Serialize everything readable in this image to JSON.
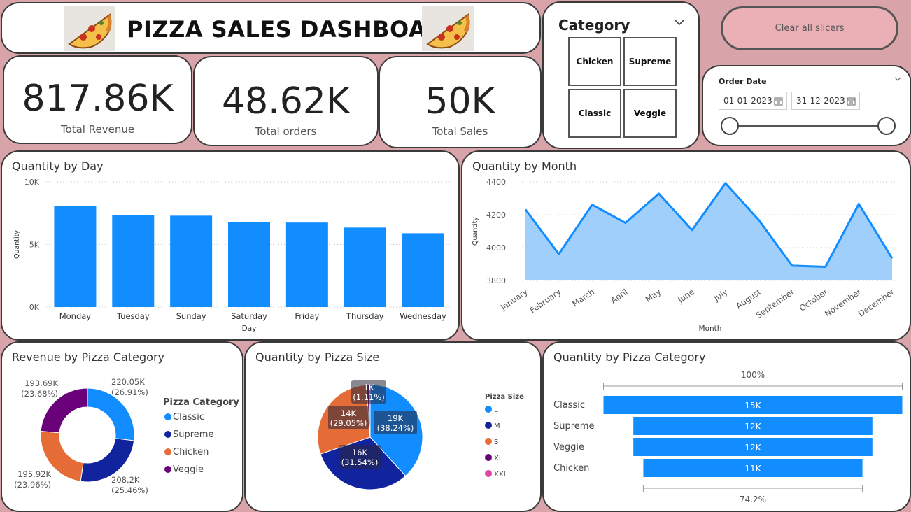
{
  "header": {
    "title": "PIZZA SALES DASHBOARD"
  },
  "kpis": [
    {
      "value": "817.86K",
      "label": "Total Revenue"
    },
    {
      "value": "48.62K",
      "label": "Total orders"
    },
    {
      "value": "50K",
      "label": "Total Sales"
    }
  ],
  "category_slicer": {
    "title": "Category",
    "options": [
      "Chicken",
      "Supreme",
      "Classic",
      "Veggie"
    ]
  },
  "clear_button": {
    "label": "Clear all slicers"
  },
  "date_slicer": {
    "title": "Order Date",
    "start": "01-01-2023",
    "end": "31-12-2023"
  },
  "colors": {
    "accent": "#118dff",
    "background": "#d8a4aa",
    "dark_blue": "#12239e",
    "orange": "#e66c37",
    "purple": "#6b007b",
    "pink": "#e044a7",
    "area_fill": "#a0cffb"
  },
  "chart_data": [
    {
      "type": "bar",
      "title": "Quantity by Day",
      "xlabel": "Day",
      "ylabel": "Quantity",
      "categories": [
        "Monday",
        "Tuesday",
        "Sunday",
        "Saturday",
        "Friday",
        "Thursday",
        "Wednesday"
      ],
      "values": [
        8100,
        7350,
        7300,
        6800,
        6750,
        6350,
        5900
      ],
      "ylim": [
        0,
        10000
      ],
      "ticks": [
        "0K",
        "5K",
        "10K"
      ]
    },
    {
      "type": "area",
      "title": "Quantity by Month",
      "xlabel": "Month",
      "ylabel": "Quantity",
      "categories": [
        "January",
        "February",
        "March",
        "April",
        "May",
        "June",
        "July",
        "August",
        "September",
        "October",
        "November",
        "December"
      ],
      "values": [
        4232,
        3961,
        4261,
        4151,
        4328,
        4107,
        4392,
        4168,
        3890,
        3883,
        4266,
        3935
      ],
      "ylim": [
        3800,
        4400
      ],
      "ticks": [
        "3800",
        "4000",
        "4200",
        "4400"
      ]
    },
    {
      "type": "pie",
      "donut": true,
      "title": "Revenue by Pizza Category",
      "legend_title": "Pizza Category",
      "labels": [
        "Classic",
        "Supreme",
        "Chicken",
        "Veggie"
      ],
      "values": [
        220.05,
        208.2,
        195.92,
        193.69
      ],
      "value_labels": [
        "220.05K",
        "208.2K",
        "195.92K",
        "193.69K"
      ],
      "percent_labels": [
        "(26.91%)",
        "(25.46%)",
        "(23.96%)",
        "(23.68%)"
      ]
    },
    {
      "type": "pie",
      "title": "Quantity by Pizza Size",
      "legend_title": "Pizza Size",
      "labels": [
        "L",
        "M",
        "S",
        "XL",
        "XXL"
      ],
      "values": [
        38.24,
        31.54,
        29.05,
        1.11,
        0.06
      ],
      "value_labels": [
        "19K",
        "16K",
        "14K",
        "1K",
        ""
      ],
      "percent_labels": [
        "(38.24%)",
        "(31.54%)",
        "(29.05%)",
        "(1.11%)",
        ""
      ]
    },
    {
      "type": "funnel",
      "title": "Quantity by Pizza Category",
      "categories": [
        "Classic",
        "Supreme",
        "Veggie",
        "Chicken"
      ],
      "values": [
        15000,
        12000,
        12000,
        11000
      ],
      "value_labels": [
        "15K",
        "12K",
        "12K",
        "11K"
      ],
      "top_label": "100%",
      "bottom_label": "74.2%"
    }
  ]
}
